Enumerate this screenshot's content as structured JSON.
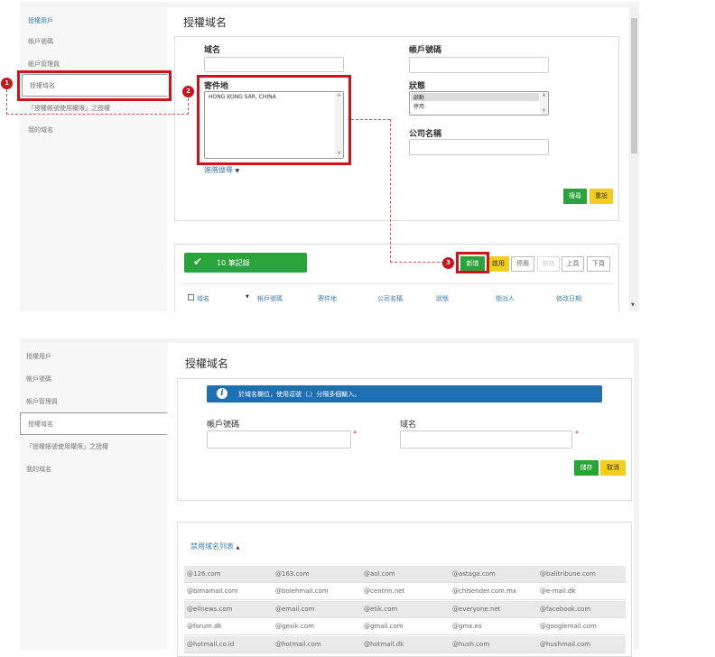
{
  "panel1": {
    "sidebar": [
      "授權用戶",
      "帳戶號碼",
      "帳戶管理員",
      "授權域名",
      "「授權帳號使用權限」之授權",
      "我的域名"
    ],
    "title": "授權域名",
    "search": {
      "domain_label": "域名",
      "domain_value": "",
      "sender_label": "寄件地",
      "sender_value": "HONG KONG SAR, CHINA",
      "advanced_label": "進階搜尋",
      "account_label": "帳戶號碼",
      "account_value": "",
      "status_label": "狀態",
      "status_options": [
        "啟動",
        "停用"
      ],
      "status_selected": "啟動",
      "company_label": "公司名稱",
      "company_value": "",
      "search_button": "搜尋",
      "reset_button": "重設"
    },
    "results": {
      "record_count": "10 筆記錄",
      "buttons": {
        "add": "新增",
        "enable": "啟用",
        "disable": "停用",
        "delete": "刪除",
        "prev": "上頁",
        "next": "下頁"
      },
      "columns": [
        "域名",
        "帳戶號碼",
        "寄件地",
        "公司名稱",
        "狀態",
        "指派人",
        "修改日期"
      ]
    },
    "callouts": [
      "1",
      "2",
      "3"
    ]
  },
  "panel2": {
    "sidebar": [
      "授權用戶",
      "帳戶號碼",
      "帳戶管理員",
      "授權域名",
      "「授權帳號使用權限」之授權",
      "我的域名"
    ],
    "title": "授權域名",
    "info": "於域名欄位，使用逗號（,）分隔多個輸入。",
    "account_label": "帳戶號碼",
    "account_value": "",
    "domain_label": "域名",
    "domain_value": "",
    "required_mark": "*",
    "save_button": "儲存",
    "cancel_button": "取消",
    "blocked_link": "禁用域名列表",
    "blocked_domains": [
      [
        "@126.com",
        "@163.com",
        "@aol.com",
        "@astaga.com",
        "@balitribune.com"
      ],
      [
        "@bimamail.com",
        "@bolehmail.com",
        "@centrin.net",
        "@chisender.com.mx",
        "@e-mail.dk"
      ],
      [
        "@ellnews.com",
        "@email.com",
        "@etik.com",
        "@everyone.net",
        "@facebook.com"
      ],
      [
        "@forum.dk",
        "@gexik.com",
        "@gmail.com",
        "@gmx.es",
        "@googlemail.com"
      ],
      [
        "@hotmail.co.id",
        "@hotmail.com",
        "@hotmail.dk",
        "@hush.com",
        "@hushmail.com"
      ]
    ]
  },
  "colors": {
    "green": "#2aa33a",
    "yellow": "#f3cf1c",
    "callout_red": "#d0121b",
    "info_blue": "#1f6fb5",
    "link_blue": "#3b7fb0"
  }
}
